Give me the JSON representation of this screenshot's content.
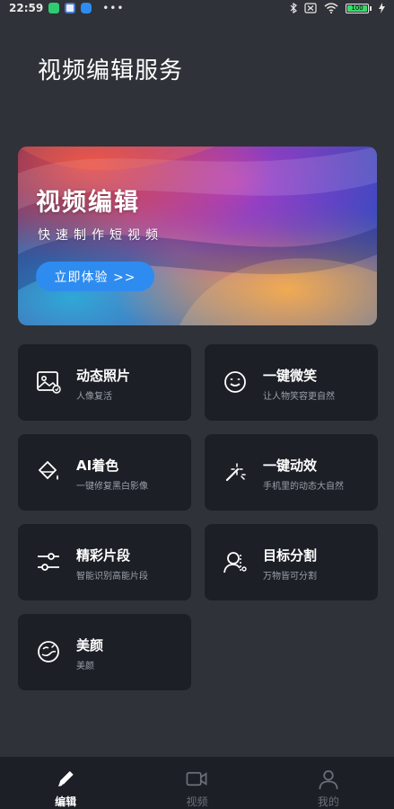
{
  "status_bar": {
    "time": "22:59",
    "dots": "•••",
    "battery_level": "100",
    "battery_color": "#3cd86a"
  },
  "page": {
    "title": "视频编辑服务"
  },
  "banner": {
    "title": "视频编辑",
    "subtitle": "快速制作短视频",
    "button_label": "立即体验 >>",
    "button_color": "#2e8cf0"
  },
  "features": [
    {
      "title": "动态照片",
      "desc": "人像复活",
      "icon": "photo-icon"
    },
    {
      "title": "一键微笑",
      "desc": "让人物笑容更自然",
      "icon": "smile-icon"
    },
    {
      "title": "AI着色",
      "desc": "一键修复黑白影像",
      "icon": "paint-bucket-icon"
    },
    {
      "title": "一键动效",
      "desc": "手机里的动态大自然",
      "icon": "magic-wand-icon"
    },
    {
      "title": "精彩片段",
      "desc": "智能识别高能片段",
      "icon": "sliders-icon"
    },
    {
      "title": "目标分割",
      "desc": "万物皆可分割",
      "icon": "person-segment-icon"
    },
    {
      "title": "美颜",
      "desc": "美颜",
      "icon": "beauty-face-icon"
    }
  ],
  "bottom_nav": [
    {
      "label": "编辑",
      "icon": "pencil-icon",
      "active": true
    },
    {
      "label": "视频",
      "icon": "video-camera-icon",
      "active": false
    },
    {
      "label": "我的",
      "icon": "user-icon",
      "active": false
    }
  ],
  "colors": {
    "background": "#2f3238",
    "card": "#1c1f26",
    "desc_text": "#9aa0a8",
    "inactive_nav": "#6b7078"
  }
}
